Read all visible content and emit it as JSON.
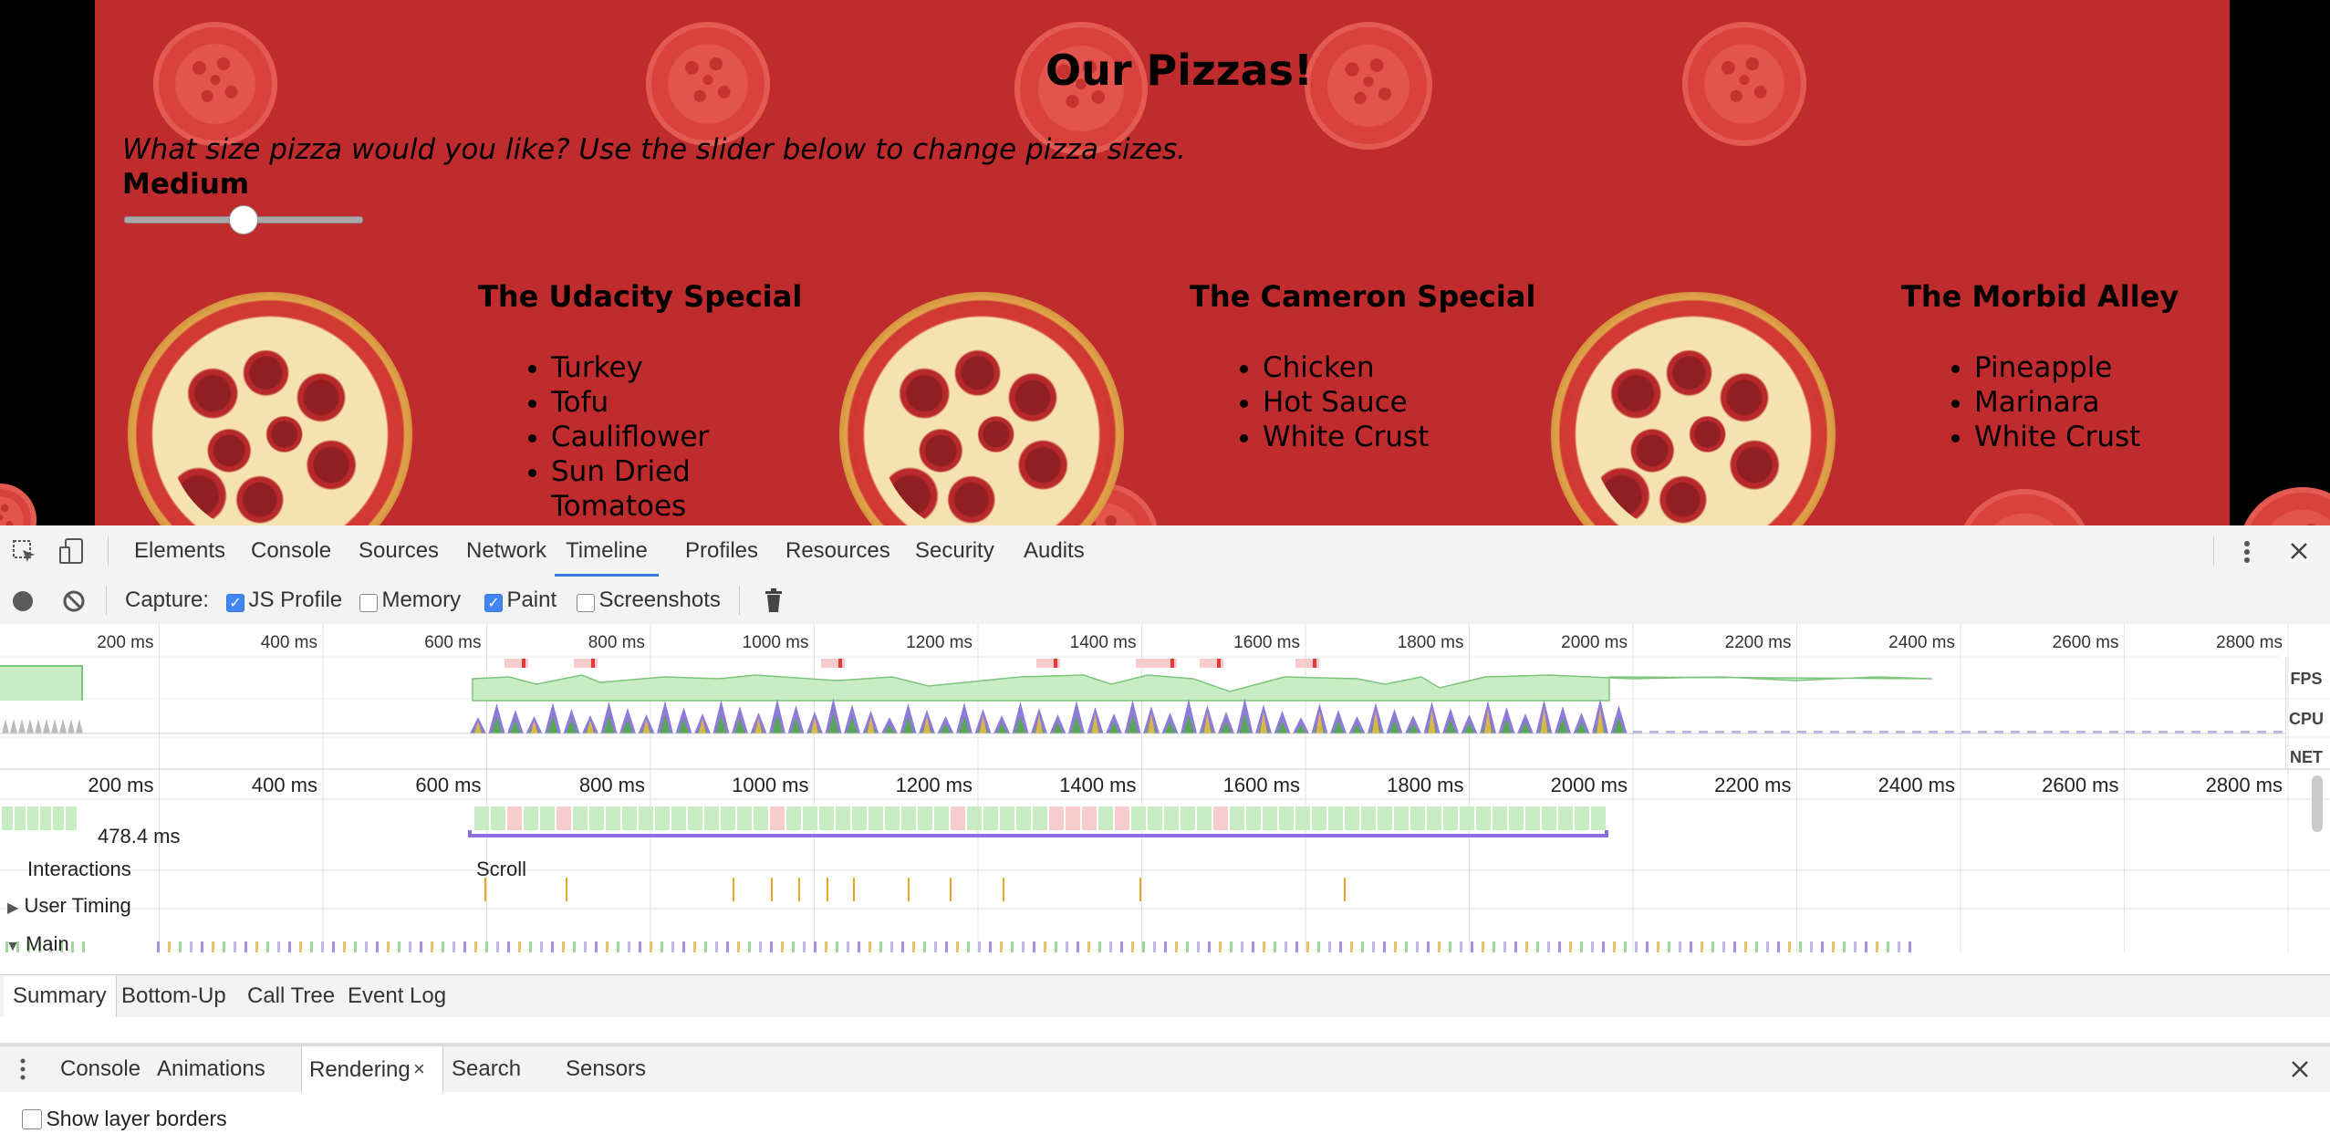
{
  "site": {
    "title": "Our Pizzas!",
    "question": "What size pizza would you like? Use the slider below to change pizza sizes.",
    "size_label": "Medium",
    "slider_fraction": 0.5,
    "pizzas": [
      {
        "name": "The Udacity Special",
        "ingredients": [
          "Turkey",
          "Tofu",
          "Cauliflower",
          "Sun Dried",
          "Tomatoes"
        ]
      },
      {
        "name": "The Cameron Special",
        "ingredients": [
          "Chicken",
          "Hot Sauce",
          "White Crust"
        ]
      },
      {
        "name": "The Morbid Alley",
        "ingredients": [
          "Pineapple",
          "Marinara",
          "White Crust"
        ]
      }
    ]
  },
  "devtools": {
    "tabs": [
      "Elements",
      "Console",
      "Sources",
      "Network",
      "Timeline",
      "Profiles",
      "Resources",
      "Security",
      "Audits"
    ],
    "active_tab": "Timeline",
    "capture_label": "Capture:",
    "capture_options": [
      {
        "label": "JS Profile",
        "checked": true
      },
      {
        "label": "Memory",
        "checked": false
      },
      {
        "label": "Paint",
        "checked": true
      },
      {
        "label": "Screenshots",
        "checked": false
      }
    ],
    "overview_ticks": [
      "200 ms",
      "400 ms",
      "600 ms",
      "800 ms",
      "1000 ms",
      "1200 ms",
      "1400 ms",
      "1600 ms",
      "1800 ms",
      "2000 ms",
      "2200 ms",
      "2400 ms",
      "2600 ms",
      "2800 ms"
    ],
    "overview_labels": [
      "FPS",
      "CPU",
      "NET"
    ],
    "flame_ticks": [
      "200 ms",
      "400 ms",
      "600 ms",
      "800 ms",
      "1000 ms",
      "1200 ms",
      "1400 ms",
      "1600 ms",
      "1800 ms",
      "2000 ms",
      "2200 ms",
      "2400 ms",
      "2600 ms",
      "2800 ms"
    ],
    "frame_duration": "478.4 ms",
    "interactions_label": "Interactions",
    "scroll_label": "Scroll",
    "user_timing_label": "User Timing",
    "main_label": "Main",
    "bottom_tabs": [
      "Summary",
      "Bottom-Up",
      "Call Tree",
      "Event Log"
    ],
    "active_bottom_tab": "Summary",
    "drawer_tabs": [
      "Console",
      "Animations",
      "Rendering",
      "Search",
      "Sensors"
    ],
    "active_drawer_tab": "Rendering",
    "rendering_option": "Show layer borders"
  },
  "colors": {
    "site_bg": "#c02b2d",
    "fps_green": "#c8ecc4",
    "fps_red": "#f7cccc",
    "cpu_purple": "#8e7bd9",
    "cpu_yellow": "#e8b84a",
    "cpu_green": "#5aa55a",
    "scroll_line": "#8d6fe0",
    "accent_blue": "#3879d9"
  }
}
